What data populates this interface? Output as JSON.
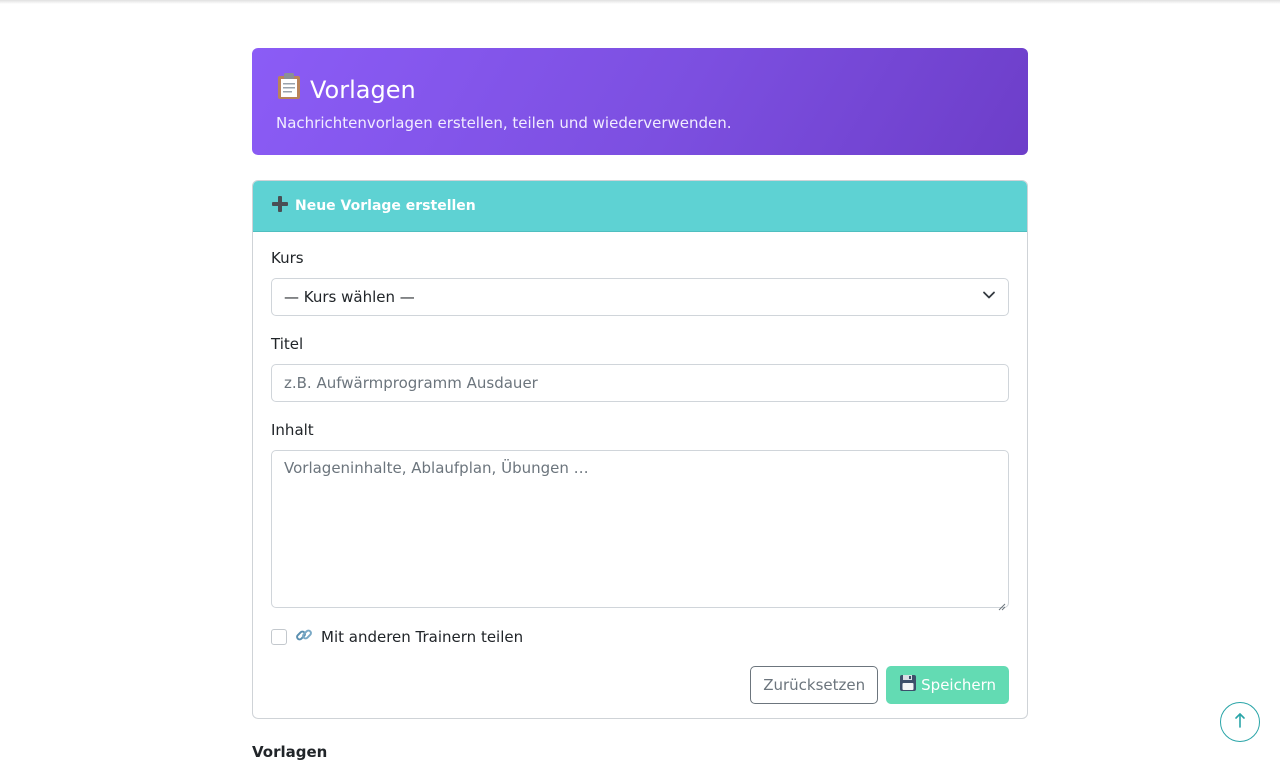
{
  "header": {
    "title": "Vorlagen",
    "title_icon": "clipboard-icon",
    "subtitle": "Nachrichtenvorlagen erstellen, teilen und wiederverwenden."
  },
  "form": {
    "header_label": "Neue Vorlage erstellen",
    "header_icon": "plus-icon",
    "course_label": "Kurs",
    "course_selected": "— Kurs wählen —",
    "title_label": "Titel",
    "title_placeholder": "z.B. Aufwärmprogramm Ausdauer",
    "content_label": "Inhalt",
    "content_placeholder": "Vorlageninhalte, Ablaufplan, Übungen …",
    "share_label": "Mit anderen Trainern teilen",
    "share_icon": "link-icon",
    "reset_label": "Zurücksetzen",
    "save_label": "Speichern",
    "save_icon": "floppy-disk-icon"
  },
  "templates_section": {
    "title": "Vorlagen"
  },
  "colors": {
    "hero_gradient": [
      "#8b5cf6",
      "#6d3ec9"
    ],
    "form_header": "#5ed2d3",
    "save_button": "#63dbb3",
    "to_top_border": "#2aa5a8"
  }
}
